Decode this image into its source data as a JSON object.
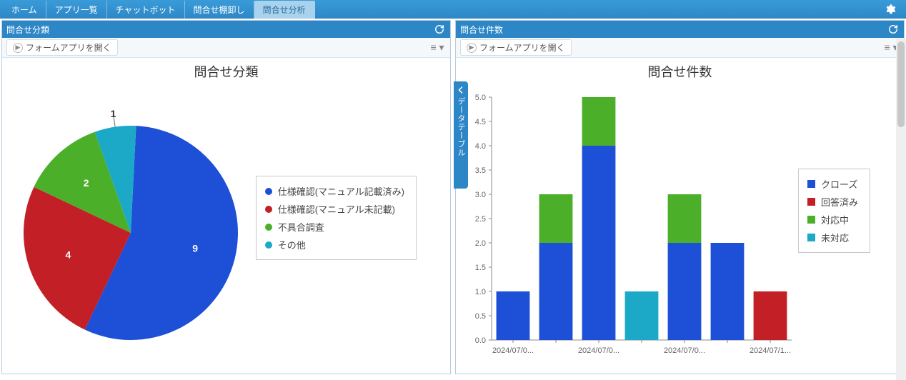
{
  "tabbar": {
    "tabs": [
      {
        "label": "ホーム"
      },
      {
        "label": "アプリ一覧"
      },
      {
        "label": "チャットボット"
      },
      {
        "label": "問合せ棚卸し"
      },
      {
        "label": "問合せ分析"
      }
    ],
    "active_index": 4
  },
  "panel_left": {
    "title": "問合せ分類",
    "open_form_label": "フォームアプリを開く"
  },
  "panel_right": {
    "title": "問合せ件数",
    "open_form_label": "フォームアプリを開く"
  },
  "side_ribbon_label": "データテーブル",
  "chart_data": [
    {
      "id": "pie",
      "type": "pie",
      "title": "問合せ分類",
      "series": [
        {
          "name": "仕様確認(マニュアル記載済み)",
          "value": 9,
          "color": "#1d4fd7"
        },
        {
          "name": "仕様確認(マニュアル未記載)",
          "value": 4,
          "color": "#c22026"
        },
        {
          "name": "不具合調査",
          "value": 2,
          "color": "#4caf2a"
        },
        {
          "name": "その他",
          "value": 1,
          "color": "#1ba9c7"
        }
      ],
      "legend_position": "right",
      "data_labels": [
        "9",
        "4",
        "2",
        "1"
      ]
    },
    {
      "id": "bar",
      "type": "bar",
      "stacked": true,
      "title": "問合せ件数",
      "ylim": [
        0,
        5
      ],
      "yticks": [
        0,
        0.5,
        1.0,
        1.5,
        2.0,
        2.5,
        3.0,
        3.5,
        4.0,
        4.5,
        5.0
      ],
      "categories": [
        "2024/07/0...",
        "",
        "2024/07/0...",
        "",
        "2024/07/0...",
        "",
        "2024/07/1..."
      ],
      "series": [
        {
          "name": "クローズ",
          "color": "#1d4fd7",
          "values": [
            1,
            2,
            4,
            0,
            2,
            2,
            0
          ]
        },
        {
          "name": "回答済み",
          "color": "#c22026",
          "values": [
            0,
            0,
            0,
            0,
            0,
            0,
            1
          ]
        },
        {
          "name": "対応中",
          "color": "#4caf2a",
          "values": [
            0,
            1,
            1,
            0,
            1,
            0,
            0
          ]
        },
        {
          "name": "未対応",
          "color": "#1ba9c7",
          "values": [
            0,
            0,
            0,
            1,
            0,
            0,
            0
          ]
        }
      ],
      "legend_position": "right"
    }
  ]
}
